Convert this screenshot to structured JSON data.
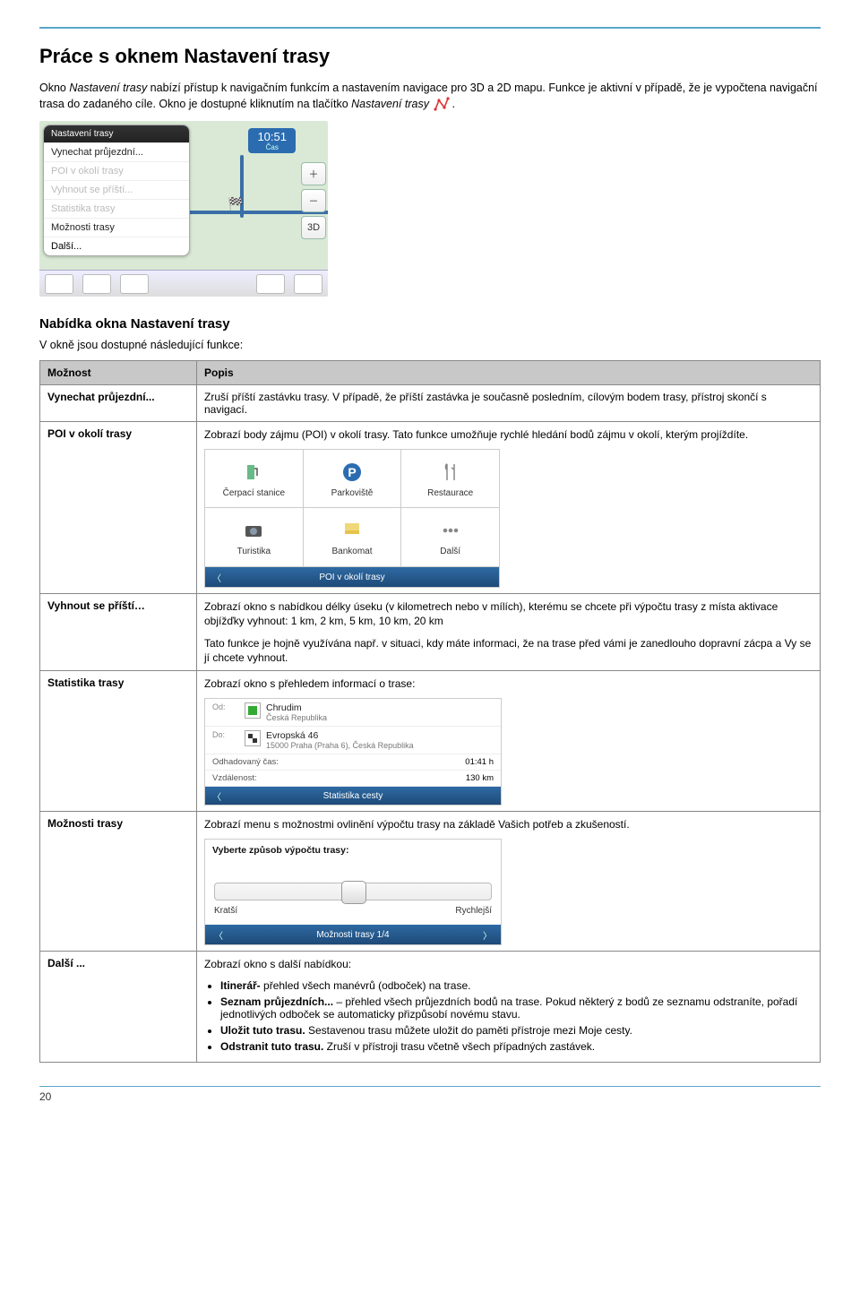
{
  "header": {
    "title": "Práce s oknem Nastavení trasy"
  },
  "intro": {
    "p1_a": "Okno ",
    "p1_b_i": "Nastavení trasy",
    "p1_c": " nabízí přístup k navigačním funkcím a nastavením navigace pro 3D a 2D mapu. Funkce je aktivní v případě, že je vypočtena navigační trasa do zadaného cíle. Okno je dostupné kliknutím na tlačítko ",
    "p1_d_i": "Nastavení trasy",
    "p1_e": " ",
    "p1_f": "."
  },
  "navscreen": {
    "menu_title": "Nastavení trasy",
    "items": [
      {
        "label": "Vynechat průjezdní...",
        "disabled": false
      },
      {
        "label": "POI v okolí trasy",
        "disabled": true
      },
      {
        "label": "Vyhnout se příští...",
        "disabled": true
      },
      {
        "label": "Statistika trasy",
        "disabled": true
      },
      {
        "label": "Možnosti trasy",
        "disabled": false
      },
      {
        "label": "Další...",
        "disabled": false
      }
    ],
    "clock": "10:51",
    "clock_sub": "Čas",
    "btn3d": "3D",
    "flag": "🏁"
  },
  "section2": {
    "title": "Nabídka okna Nastavení trasy",
    "sub": "V okně jsou dostupné následující funkce:"
  },
  "table": {
    "th1": "Možnost",
    "th2": "Popis",
    "rows": [
      {
        "opt": "Vynechat průjezdní...",
        "desc": "Zruší příští zastávku trasy. V případě, že příští zastávka je současně posledním, cílovým bodem trasy, přístroj skončí s navigací."
      },
      {
        "opt": "POI v okolí trasy",
        "desc": "Zobrazí body zájmu (POI) v okolí trasy. Tato funkce umožňuje rychlé hledání bodů zájmu v okolí, kterým projíždíte."
      },
      {
        "opt": "Vyhnout se příští…",
        "desc_p1": "Zobrazí okno s nabídkou délky úseku (v kilometrech nebo v mílích), kterému se chcete při výpočtu trasy z místa aktivace objížďky vyhnout: 1 km, 2 km, 5 km, 10 km, 20 km",
        "desc_p2": "Tato funkce je hojně využívána např. v situaci, kdy máte informaci, že na trase před vámi je zanedlouho dopravní zácpa a Vy se jí chcete vyhnout."
      },
      {
        "opt": "Statistika trasy",
        "desc": "Zobrazí okno s přehledem informací o trase:"
      },
      {
        "opt": "Možnosti trasy",
        "desc": "Zobrazí menu s možnostmi ovlinění výpočtu trasy na základě Vašich potřeb a zkušeností."
      },
      {
        "opt": "Další ...",
        "desc": "Zobrazí okno s další nabídkou:",
        "bullets": [
          {
            "bold": "Itinerář-",
            "rest": " přehled všech manévrů (odboček) na trase."
          },
          {
            "bold": "Seznam průjezdních...",
            "rest": " – přehled všech průjezdních bodů na trase. Pokud některý z bodů ze seznamu odstraníte, pořadí jednotlivých odboček se automaticky přizpůsobí novému stavu."
          },
          {
            "bold": "Uložit tuto trasu.",
            "rest": " Sestavenou trasu můžete uložit do paměti přístroje mezi Moje cesty."
          },
          {
            "bold": "Odstranit tuto trasu.",
            "rest": " Zruší v přístroji trasu včetně všech případných zastávek."
          }
        ]
      }
    ]
  },
  "poi": {
    "cells": [
      "Čerpací stanice",
      "Parkoviště",
      "Restaurace",
      "Turistika",
      "Bankomat",
      "Další"
    ],
    "bar": "POI v okolí trasy"
  },
  "stats": {
    "od": "Od:",
    "od_city": "Chrudim",
    "od_country": "Česká Republika",
    "do": "Do:",
    "do_street": "Evropská 46",
    "do_city": "15000 Praha (Praha 6), Česká Republika",
    "eta_lbl": "Odhadovaný čas:",
    "eta_val": "01:41 h",
    "dist_lbl": "Vzdálenost:",
    "dist_val": "130 km",
    "bar": "Statistika cesty"
  },
  "routeopt": {
    "hdr": "Vyberte způsob výpočtu trasy:",
    "left": "Kratší",
    "right": "Rychlejší",
    "bar": "Možnosti trasy 1/4"
  },
  "page_number": "20"
}
